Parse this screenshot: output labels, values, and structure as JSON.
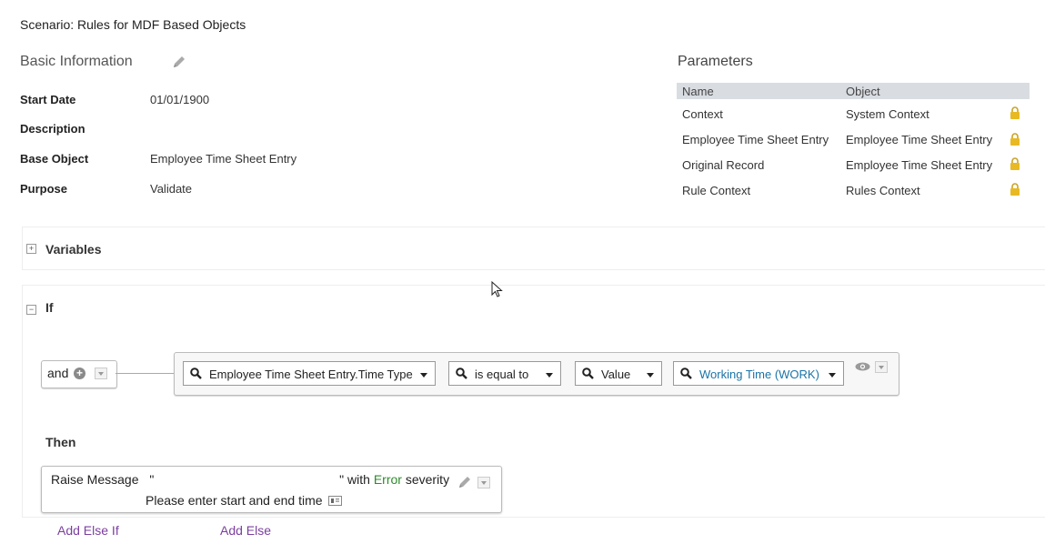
{
  "scenario_title": "Scenario: Rules for MDF Based Objects",
  "basic_info": {
    "title": "Basic Information",
    "fields": [
      {
        "label": "Start Date",
        "value": "01/01/1900"
      },
      {
        "label": "Description",
        "value": ""
      },
      {
        "label": "Base Object",
        "value": "Employee Time Sheet Entry"
      },
      {
        "label": "Purpose",
        "value": "Validate"
      }
    ]
  },
  "parameters": {
    "title": "Parameters",
    "columns": [
      "Name",
      "Object"
    ],
    "rows": [
      {
        "name": "Context",
        "object": "System Context"
      },
      {
        "name": "Employee Time Sheet Entry",
        "object": "Employee Time Sheet Entry"
      },
      {
        "name": "Original Record",
        "object": "Employee Time Sheet Entry"
      },
      {
        "name": "Rule Context",
        "object": "Rules Context"
      }
    ]
  },
  "variables": {
    "title": "Variables",
    "toggle": "+"
  },
  "if_block": {
    "title": "If",
    "toggle": "−",
    "operator": "and",
    "condition": {
      "left": "Employee Time Sheet Entry.Time Type",
      "comparator": "is equal to",
      "type": "Value",
      "right": "Working Time (WORK)"
    }
  },
  "then_block": {
    "title": "Then",
    "action_prefix": "Raise Message",
    "quote_open": "\"",
    "quote_close_with": "\" with",
    "severity": "Error",
    "severity_suffix": "severity",
    "message": "Please enter start and end time"
  },
  "links": {
    "add_else_if": "Add Else If",
    "add_else": "Add Else"
  },
  "colors": {
    "accent_link": "#1a73a8",
    "severity": "#2e8b2e",
    "action_link": "#7b3fa0",
    "lock": "#e8b923"
  }
}
